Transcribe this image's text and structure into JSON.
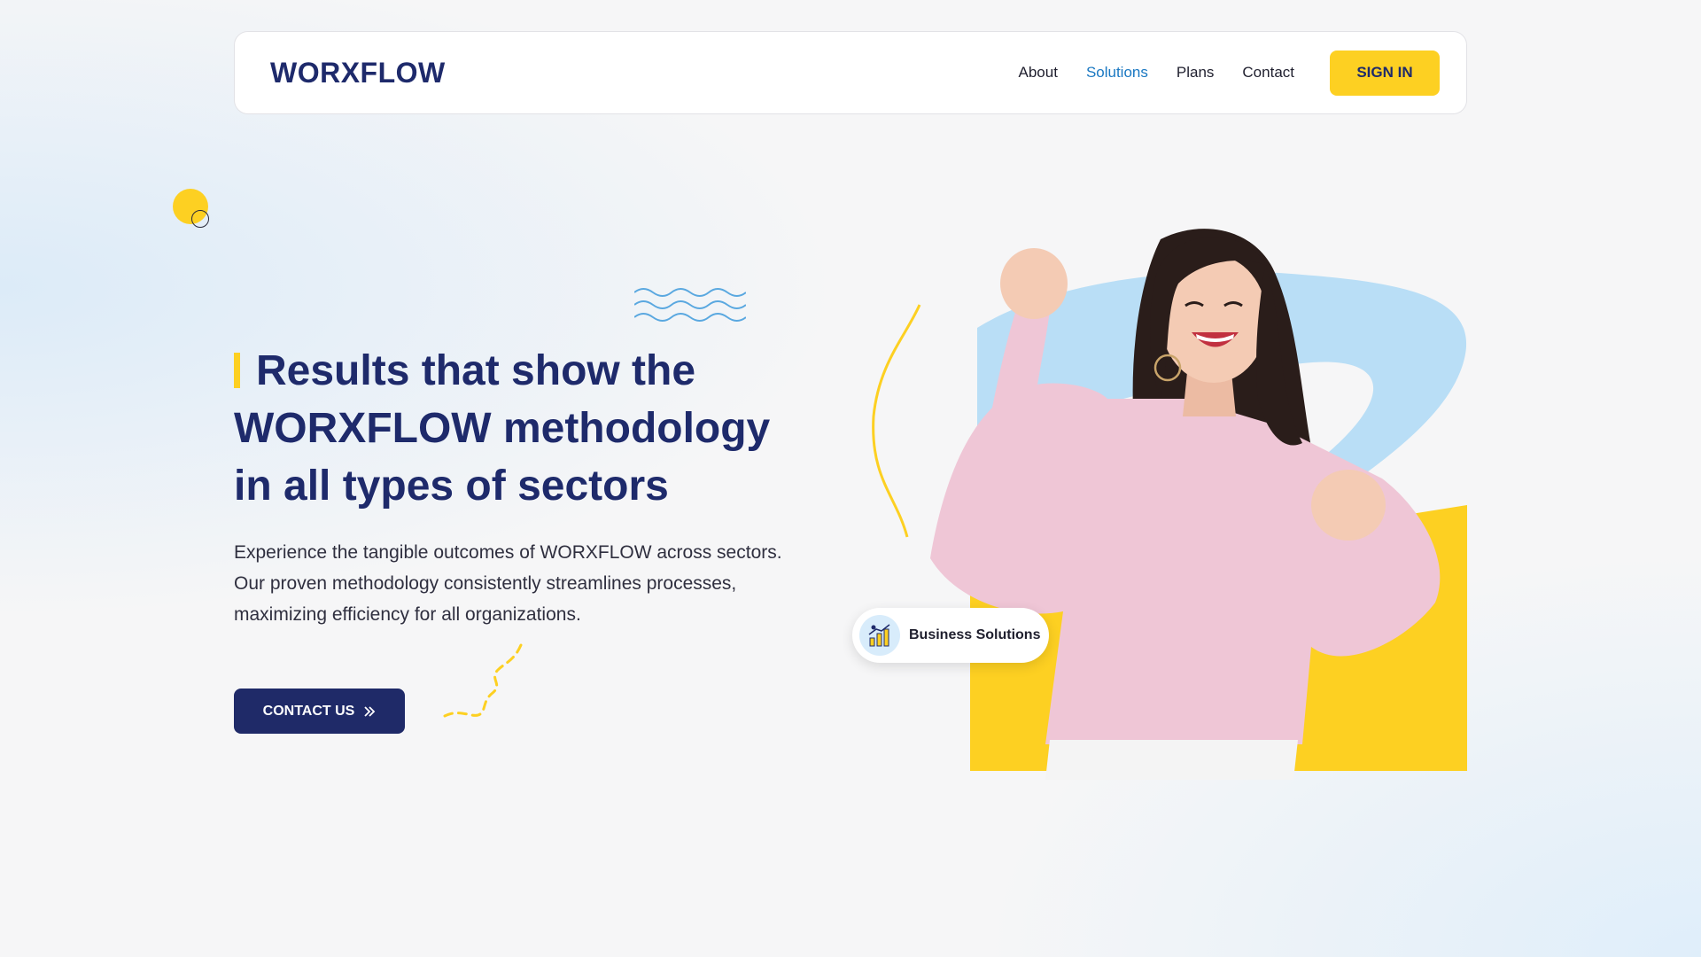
{
  "brand": {
    "logo_text": "WORXFLOW"
  },
  "nav": {
    "items": [
      {
        "label": "About",
        "active": false
      },
      {
        "label": "Solutions",
        "active": true
      },
      {
        "label": "Plans",
        "active": false
      },
      {
        "label": "Contact",
        "active": false
      }
    ],
    "signin_label": "SIGN IN"
  },
  "hero": {
    "line1": "Results that show the",
    "line2": "WORXFLOW methodology",
    "line3_normal": "in all types of ",
    "line3_bold": "sectors",
    "description": "Experience the tangible outcomes of WORXFLOW across sectors. Our proven methodology consistently streamlines processes, maximizing efficiency for all organizations.",
    "cta_label": "CONTACT US"
  },
  "badge": {
    "label": "Business Solutions",
    "icon": "business-chart-icon"
  },
  "colors": {
    "navy": "#1e2a6b",
    "yellow": "#fdd022",
    "light_blue": "#b9def6",
    "active_link": "#1a78c2"
  }
}
